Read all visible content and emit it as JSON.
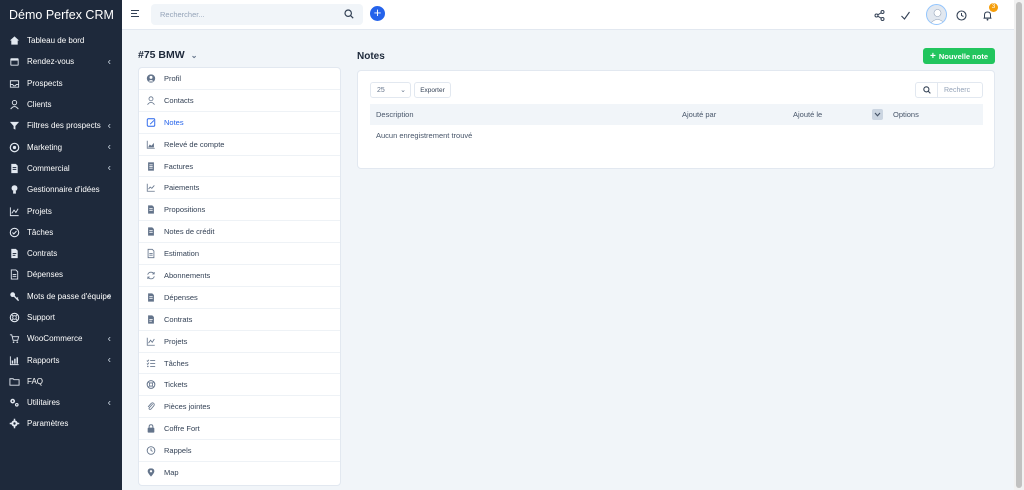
{
  "brand": "Démo Perfex CRM",
  "sidebar": {
    "items": [
      {
        "label": "Tableau de bord",
        "icon": "home-icon",
        "chevron": false
      },
      {
        "label": "Rendez-vous",
        "icon": "calendar-icon",
        "chevron": true
      },
      {
        "label": "Prospects",
        "icon": "tray-icon",
        "chevron": false
      },
      {
        "label": "Clients",
        "icon": "user-icon",
        "chevron": false
      },
      {
        "label": "Filtres des prospects",
        "icon": "filter-icon",
        "chevron": true
      },
      {
        "label": "Marketing",
        "icon": "target-icon",
        "chevron": true
      },
      {
        "label": "Commercial",
        "icon": "document-icon",
        "chevron": true
      },
      {
        "label": "Gestionnaire d'idées",
        "icon": "lightbulb-icon",
        "chevron": false
      },
      {
        "label": "Projets",
        "icon": "chart-icon",
        "chevron": false
      },
      {
        "label": "Tâches",
        "icon": "check-circle-icon",
        "chevron": false
      },
      {
        "label": "Contrats",
        "icon": "contract-icon",
        "chevron": false
      },
      {
        "label": "Dépenses",
        "icon": "file-icon",
        "chevron": false
      },
      {
        "label": "Mots de passe d'équipe",
        "icon": "key-icon",
        "chevron": true
      },
      {
        "label": "Support",
        "icon": "lifebuoy-icon",
        "chevron": false
      },
      {
        "label": "WooCommerce",
        "icon": "cart-icon",
        "chevron": true
      },
      {
        "label": "Rapports",
        "icon": "report-icon",
        "chevron": true
      },
      {
        "label": "FAQ",
        "icon": "folder-icon",
        "chevron": false
      },
      {
        "label": "Utilitaires",
        "icon": "cogs-icon",
        "chevron": true
      },
      {
        "label": "Paramètres",
        "icon": "gear-icon",
        "chevron": false
      }
    ]
  },
  "header": {
    "search_placeholder": "Rechercher...",
    "notification_count": "3"
  },
  "customer": {
    "title": "#75 BMW"
  },
  "tabs": [
    {
      "label": "Profil",
      "icon": "user-circle-icon",
      "active": false
    },
    {
      "label": "Contacts",
      "icon": "user-icon",
      "active": false
    },
    {
      "label": "Notes",
      "icon": "note-icon",
      "active": true
    },
    {
      "label": "Relevé de compte",
      "icon": "area-chart-icon",
      "active": false
    },
    {
      "label": "Factures",
      "icon": "invoice-icon",
      "active": false
    },
    {
      "label": "Paiements",
      "icon": "line-chart-icon",
      "active": false
    },
    {
      "label": "Propositions",
      "icon": "document-icon",
      "active": false
    },
    {
      "label": "Notes de crédit",
      "icon": "document-icon",
      "active": false
    },
    {
      "label": "Estimation",
      "icon": "file-icon",
      "active": false
    },
    {
      "label": "Abonnements",
      "icon": "refresh-icon",
      "active": false
    },
    {
      "label": "Dépenses",
      "icon": "document-icon",
      "active": false
    },
    {
      "label": "Contrats",
      "icon": "contract-icon",
      "active": false
    },
    {
      "label": "Projets",
      "icon": "chart-icon",
      "active": false
    },
    {
      "label": "Tâches",
      "icon": "list-check-icon",
      "active": false
    },
    {
      "label": "Tickets",
      "icon": "lifebuoy-icon",
      "active": false
    },
    {
      "label": "Pièces jointes",
      "icon": "paperclip-icon",
      "active": false
    },
    {
      "label": "Coffre Fort",
      "icon": "lock-icon",
      "active": false
    },
    {
      "label": "Rappels",
      "icon": "clock-icon",
      "active": false
    },
    {
      "label": "Map",
      "icon": "map-pin-icon",
      "active": false
    }
  ],
  "notes": {
    "title": "Notes",
    "new_button": "Nouvelle note",
    "page_size": "25",
    "export_label": "Exporter",
    "search_placeholder": "Recherc",
    "columns": [
      "Description",
      "Ajouté par",
      "Ajouté le",
      "Options"
    ],
    "empty_message": "Aucun enregistrement trouvé"
  },
  "colors": {
    "sidebar_bg": "#1e293b",
    "accent": "#2563eb",
    "success": "#22c55e",
    "badge": "#f59e0b"
  }
}
